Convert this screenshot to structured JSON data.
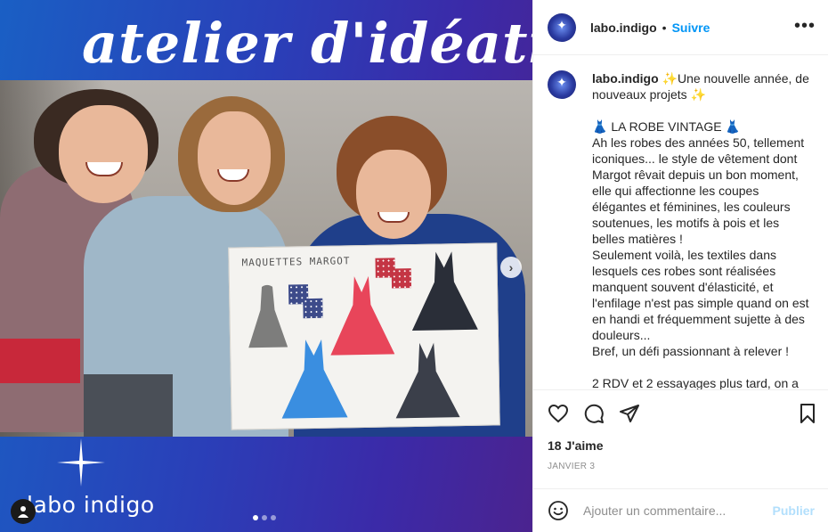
{
  "post": {
    "banner_title": "atelier d'idéation",
    "board_title": "MAQUETTES MARGOT",
    "watermark_text": "labo indigo",
    "carousel": {
      "total": 3,
      "current": 1
    }
  },
  "header": {
    "username": "labo.indigo",
    "separator": "•",
    "follow_label": "Suivre",
    "more_label": "•••"
  },
  "caption": {
    "username": "labo.indigo",
    "text": " ✨Une nouvelle année, de nouveaux projets ✨\n\n👗 LA ROBE VINTAGE 👗\nAh les robes des années 50, tellement iconiques... le style de vêtement dont Margot rêvait depuis un bon moment, elle qui affectionne les coupes élégantes et féminines, les couleurs soutenues, les motifs à pois et les belles matières !\nSeulement voilà, les textiles dans lesquels ces robes sont réalisées manquent souvent d'élasticité, et l'enfilage n'est pas simple quand on est en handi et fréquemment sujette à des douleurs...\nBref, un défi passionnant à relever !\n\n2 RDV et 2 essayages plus tard, on a"
  },
  "engagement": {
    "likes": "18 J'aime",
    "date": "JANVIER 3"
  },
  "comment": {
    "placeholder": "Ajouter un commentaire...",
    "publish_label": "Publier"
  },
  "colors": {
    "accent": "#0095f6",
    "publish_disabled": "#b2dffc",
    "banner_start": "#1a5fc4",
    "banner_end": "#4b238f"
  },
  "icons": [
    "heart-icon",
    "comment-icon",
    "share-icon",
    "bookmark-icon",
    "emoji-icon",
    "user-tag-icon",
    "chevron-right-icon",
    "more-icon"
  ]
}
